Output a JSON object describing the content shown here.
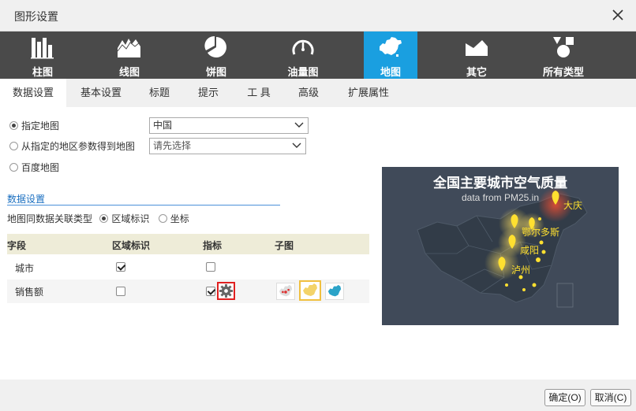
{
  "dialog": {
    "title": "图形设置"
  },
  "chart_types": [
    {
      "label": "柱图",
      "icon": "bar-chart-icon"
    },
    {
      "label": "线图",
      "icon": "line-chart-icon"
    },
    {
      "label": "饼图",
      "icon": "pie-chart-icon"
    },
    {
      "label": "油量图",
      "icon": "gauge-icon"
    },
    {
      "label": "地图",
      "icon": "map-icon",
      "active": true
    },
    {
      "label": "其它",
      "icon": "other-chart-icon"
    },
    {
      "label": "所有类型",
      "icon": "all-types-icon"
    }
  ],
  "tabs": [
    {
      "label": "数据设置",
      "active": true
    },
    {
      "label": "基本设置"
    },
    {
      "label": "标题"
    },
    {
      "label": "提示"
    },
    {
      "label": "工 具"
    },
    {
      "label": "高级"
    },
    {
      "label": "扩展属性"
    }
  ],
  "map_source": {
    "option1": {
      "label": "指定地图",
      "checked": true,
      "select_value": "中国"
    },
    "option2": {
      "label": "从指定的地区参数得到地图",
      "checked": false,
      "select_placeholder": "请先选择"
    },
    "option3": {
      "label": "百度地图",
      "checked": false
    }
  },
  "data_settings": {
    "section_title": "数据设置",
    "link_type_label": "地图同数据关联类型",
    "link_options": [
      {
        "label": "区域标识",
        "checked": true
      },
      {
        "label": "坐标",
        "checked": false
      }
    ]
  },
  "table": {
    "headers": [
      "字段",
      "区域标识",
      "指标",
      "子图"
    ],
    "rows": [
      {
        "field": "城市",
        "region": true,
        "metric": false
      },
      {
        "field": "销售额",
        "region": false,
        "metric": true
      }
    ]
  },
  "preview": {
    "title": "全国主要城市空气质量",
    "subtitle": "data from PM25.in",
    "cities": [
      "大庆",
      "鄂尔多斯",
      "咸阳",
      "泸州"
    ]
  },
  "footer": {
    "ok": "确定(O)",
    "cancel": "取消(C)"
  },
  "colors": {
    "accent": "#1a9fe0",
    "typebar": "#4a4a4a",
    "preview_bg": "#404a59",
    "city_label": "#ffe030",
    "gear_border": "#e02020"
  }
}
